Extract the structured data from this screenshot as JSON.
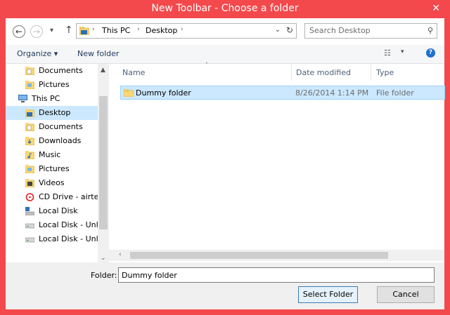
{
  "window": {
    "title": "New Toolbar - Choose a folder",
    "close_glyph": "✕"
  },
  "address": {
    "crumbs": [
      "This PC",
      "Desktop"
    ],
    "separator": "›",
    "dropdown_glyph": "⌄",
    "refresh_glyph": "↻",
    "back_glyph": "←",
    "forward_glyph": "→",
    "recent_glyph": "▾",
    "up_glyph": "↑"
  },
  "search": {
    "placeholder": "Search Desktop",
    "value": "",
    "icon": "search-icon",
    "glyph": "⚲"
  },
  "toolbar": {
    "organize_label": "Organize ▾",
    "new_folder_label": "New folder",
    "view_glyph": "☷",
    "view_dropdown_glyph": "▾",
    "help_glyph": "?"
  },
  "nav": {
    "items": [
      {
        "label": "Documents",
        "icon": "documents-icon"
      },
      {
        "label": "Pictures",
        "icon": "pictures-icon"
      },
      {
        "label": "This PC",
        "icon": "computer-icon"
      },
      {
        "label": "Desktop",
        "icon": "desktop-icon",
        "selected": true
      },
      {
        "label": "Documents",
        "icon": "documents-icon"
      },
      {
        "label": "Downloads",
        "icon": "downloads-icon"
      },
      {
        "label": "Music",
        "icon": "music-icon"
      },
      {
        "label": "Pictures",
        "icon": "pictures-icon"
      },
      {
        "label": "Videos",
        "icon": "videos-icon"
      },
      {
        "label": "CD Drive - airtel",
        "icon": "cd-drive-icon"
      },
      {
        "label": "Local Disk",
        "icon": "local-disk-icon"
      },
      {
        "label": "Local Disk - Unla",
        "icon": "drive-icon"
      },
      {
        "label": "Local Disk - Unla",
        "icon": "drive-icon"
      }
    ],
    "scroll_up_glyph": "▲",
    "scroll_down_glyph": "⌄"
  },
  "files": {
    "columns": [
      "Name",
      "Date modified",
      "Type"
    ],
    "sort_glyph": "˄",
    "rows": [
      {
        "name": "Dummy folder",
        "date": "8/26/2014 1:14 PM",
        "type": "File folder"
      }
    ],
    "hscroll_left_glyph": "‹"
  },
  "footer": {
    "folder_label": "Folder:",
    "folder_value": "Dummy folder",
    "select_label": "Select Folder",
    "cancel_label": "Cancel"
  },
  "colors": {
    "titlebar": "#f3494c",
    "selection": "#cce8ff",
    "selection_border": "#99d1ff",
    "folder": "#f8d775"
  }
}
